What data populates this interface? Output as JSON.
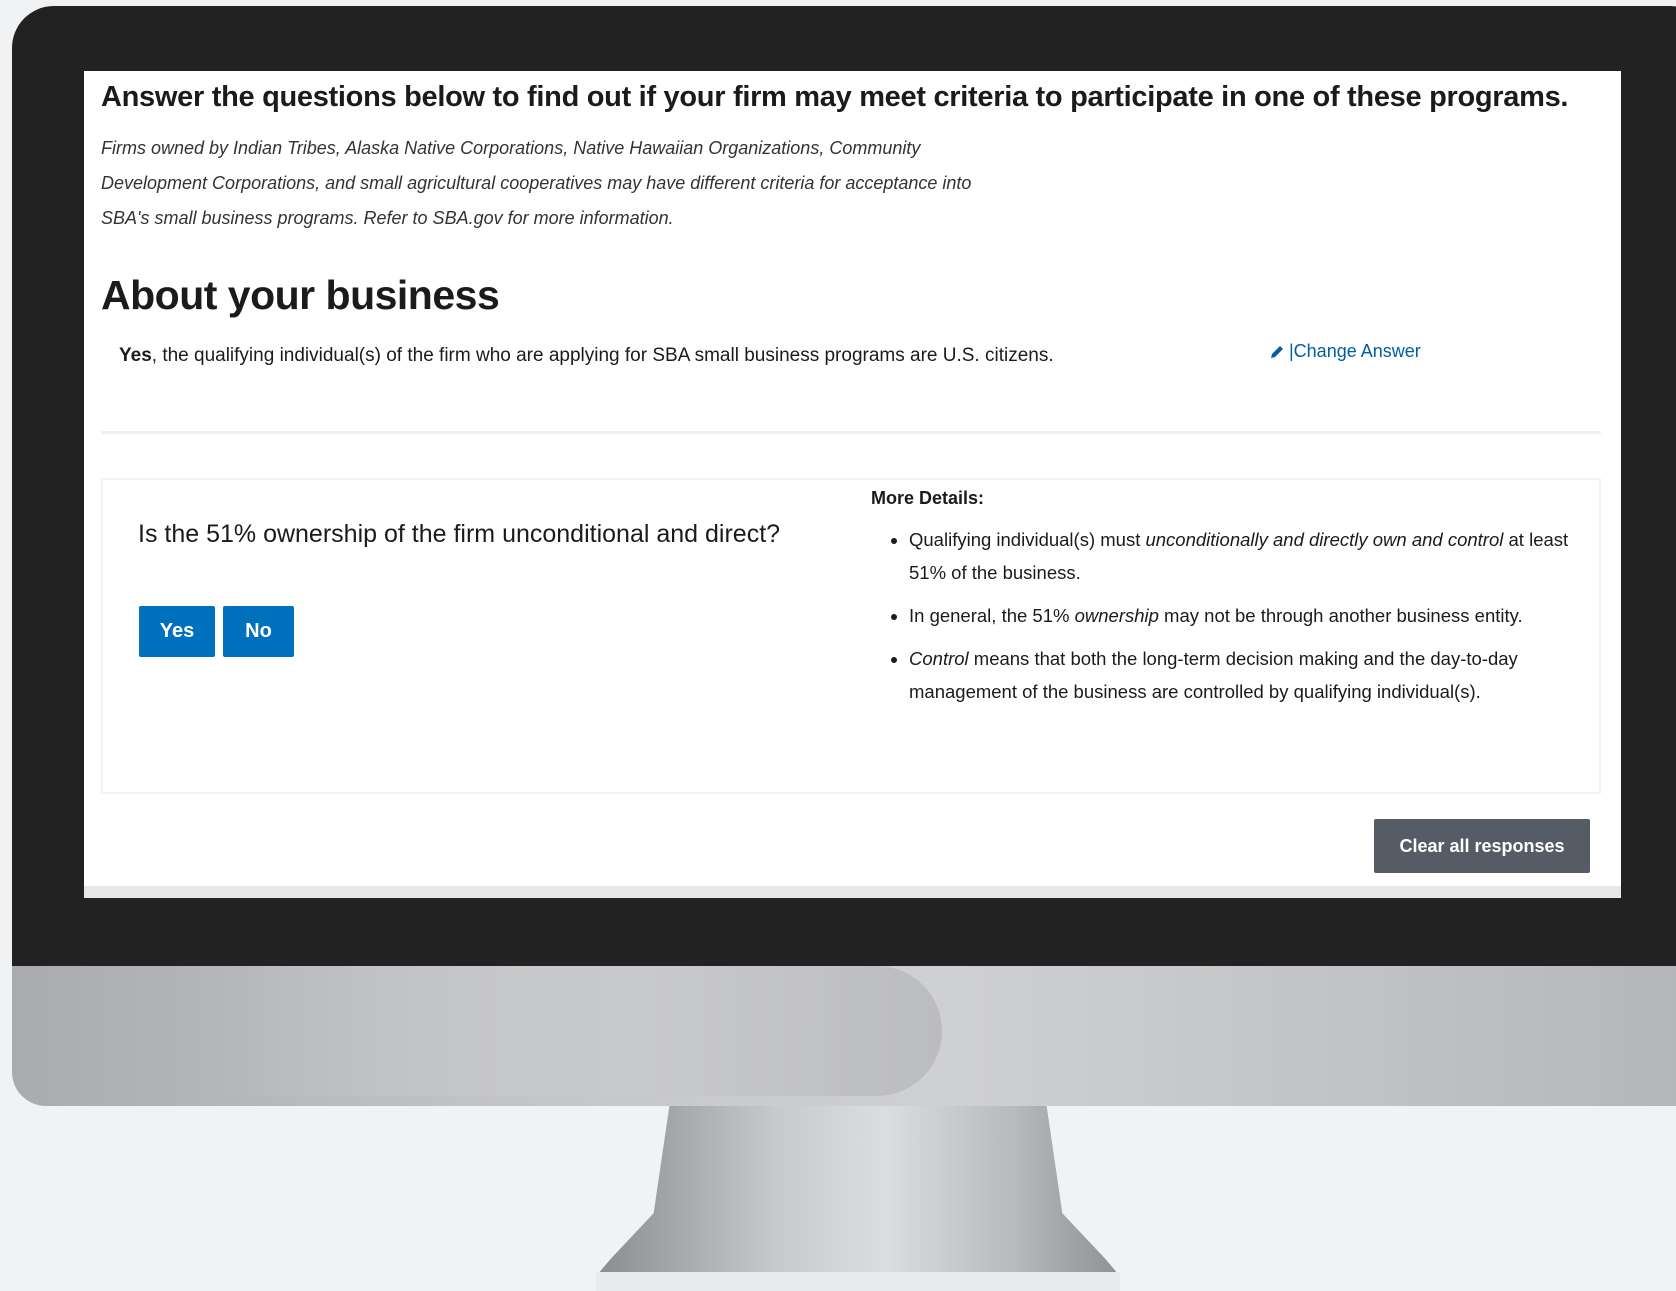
{
  "page": {
    "heading": "Answer the questions below to find out if your firm may meet criteria to participate in one of these programs.",
    "intro_note": "Firms owned by Indian Tribes, Alaska Native Corporations, Native Hawaiian Organizations, Community Development Corporations, and small agricultural cooperatives may have different criteria for acceptance into SBA's small business programs. Refer to SBA.gov for more information."
  },
  "section": {
    "title": "About your business"
  },
  "answered": {
    "answer": "Yes",
    "statement": ", the qualifying individual(s) of the firm who are applying for SBA small business programs are U.S. citizens.",
    "change_label": "|Change Answer",
    "change_icon": "pencil-icon"
  },
  "question": {
    "text": "Is the 51% ownership of the firm unconditional and direct?",
    "yes_label": "Yes",
    "no_label": "No"
  },
  "details": {
    "title": "More Details:",
    "items": [
      {
        "pre": "Qualifying individual(s) must ",
        "em": "unconditionally and directly own and control",
        "post": " at least 51% of the business."
      },
      {
        "pre": "In general, the 51% ",
        "em": "ownership",
        "post": " may not be through another business entity."
      },
      {
        "pre": "",
        "em": "Control",
        "post": " means that both the long-term decision making and the day-to-day management of the business are controlled by qualifying individual(s)."
      }
    ]
  },
  "actions": {
    "clear_label": "Clear all responses"
  },
  "colors": {
    "primary": "#0071bc",
    "link": "#005ea2",
    "secondary_button": "#565c65",
    "bezel": "#222222",
    "background": "#f1f2f4"
  }
}
